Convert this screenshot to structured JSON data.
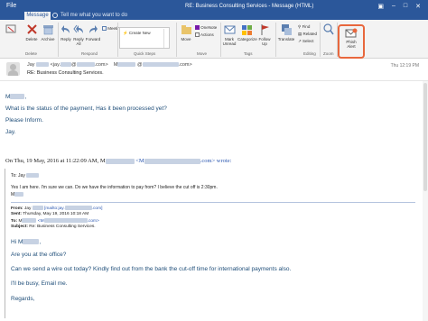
{
  "titlebar": {
    "file_tab": "File",
    "active_tab": "Message",
    "search_placeholder": "Tell me what you want to do",
    "window_title": "RE: Business Consulting Services  -  Message (HTML)",
    "accent_color": "#2b579a"
  },
  "ribbon": {
    "delete_group": {
      "label": "Delete",
      "buttons": [
        "Delete",
        "Archive"
      ]
    },
    "respond_group": {
      "label": "Respond",
      "buttons": [
        "Reply",
        "Reply All",
        "Forward"
      ],
      "meeting": "Meeting"
    },
    "quick_steps": {
      "label": "Quick Steps",
      "item": "Create New"
    },
    "move_group": {
      "label": "Move",
      "buttons": [
        "Move"
      ],
      "small": [
        "OneNote",
        "Actions"
      ]
    },
    "tags_group": {
      "label": "Tags",
      "buttons": [
        "Mark Unread",
        "Categorize",
        "Follow Up"
      ]
    },
    "editing_group": {
      "label": "Editing",
      "small": [
        "Find",
        "Related",
        "Select"
      ],
      "translate": "Translate"
    },
    "zoom_group": {
      "label": "Zoom",
      "button": "Zoom"
    },
    "phish_group": {
      "button_line1": "Phish",
      "button_line2": "Alert",
      "highlight_color": "#e8673d"
    }
  },
  "header": {
    "from_prefix": "Jay",
    "from_mid": "<jay.",
    "from_mid2": "@",
    "from_end": ".com>",
    "to_prefix": "M",
    "to_end": "@",
    "to_end2": ".com>",
    "time": "Thu 12:19 PM",
    "subject": "RE: Business Consulting Services."
  },
  "body": {
    "greeting": "M",
    "greeting_end": ",",
    "line1": "What is the status of the payment, Has it been processed yet?",
    "line2": "Please Inform.",
    "signoff": "Jay.",
    "quote_intro_a": "On Thu, 19 May, 2016 at 11:22:09 AM, M",
    "quote_intro_b": "<M",
    "quote_intro_c": ".com> wrote:"
  },
  "quoted": {
    "to_line": "To: Jay",
    "line1": "Yes I am here.  I'm sure we can.  Do we have the information to pay from?  I believe the cut off is 2:30pm.",
    "line2": "M",
    "from_label": "From:",
    "from_value_a": "Jay",
    "from_value_b": "[mailto:jay.",
    "from_value_c": ".com]",
    "sent_label": "Sent:",
    "sent_value": "Thursday, May 19, 2016 10:18 AM",
    "to_label": "To:",
    "to_value_a": "M",
    "to_value_b": "<M",
    "to_value_c": ".com>",
    "subject_label": "Subject:",
    "subject_value": "Re: Business Consulting Services.",
    "hi": "Hi M",
    "hi_end": ",",
    "q1": "Are you at the office?",
    "q2": "Can we send a wire out today? Kindly find out from the bank the cut-off time for international payments also.",
    "q3": "I'll be busy, Email me.",
    "q4": "Regards,"
  }
}
